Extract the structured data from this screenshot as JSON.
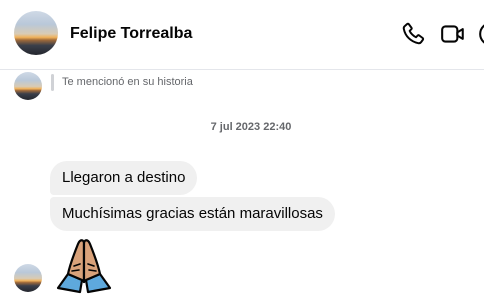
{
  "header": {
    "contact_name": "Felipe Torrealba",
    "icons": [
      "avatar",
      "phone-icon",
      "video-icon",
      "info-icon"
    ]
  },
  "story": {
    "mention_text": "Te mencionó en su historia"
  },
  "conversation": {
    "timestamp": "7 jul 2023 22:40",
    "messages": [
      {
        "text": "Llegaron a destino"
      },
      {
        "text": "Muchísimas gracias están maravillosas"
      },
      {
        "emoji": "folded-hands-emoji"
      }
    ]
  },
  "colors": {
    "bubble_background": "#f0f0f0",
    "secondary_text": "#65676b",
    "primary_text": "#050505",
    "divider": "#e4e6eb"
  }
}
